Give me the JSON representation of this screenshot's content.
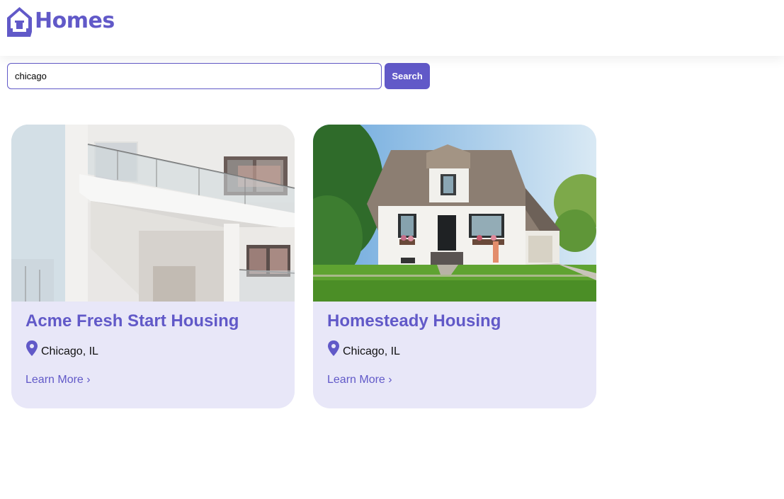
{
  "brand": {
    "name": "Homes",
    "color": "#6159c8"
  },
  "search": {
    "value": "chicago",
    "placeholder": "",
    "button_label": "Search"
  },
  "listings": [
    {
      "title": "Acme Fresh Start Housing",
      "location": "Chicago, IL",
      "link_label": "Learn More ›",
      "image": "apartment-balcony-photo"
    },
    {
      "title": "Homesteady Housing",
      "location": "Chicago, IL",
      "link_label": "Learn More ›",
      "image": "white-house-lawn-photo"
    }
  ],
  "colors": {
    "card_background": "#e8e7f8",
    "accent": "#6159c8"
  }
}
